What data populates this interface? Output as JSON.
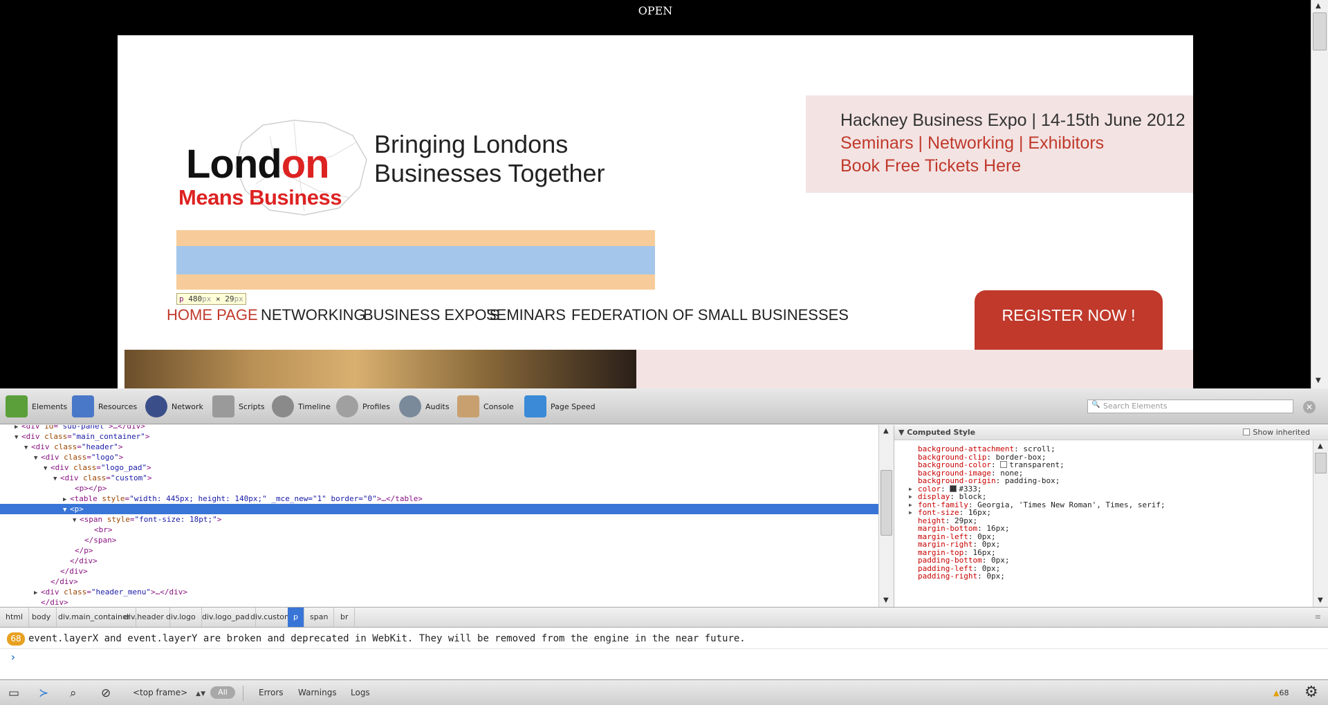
{
  "browser": {
    "open_label": "OPEN"
  },
  "website": {
    "logo": {
      "word_lond": "Lond",
      "word_on": "on",
      "subtitle": "Means Business"
    },
    "tagline_line1": "Bringing Londons",
    "tagline_line2": "Businesses Together",
    "expo": {
      "title": "Hackney Business Expo | 14-15th June 2012",
      "links": "Seminars | Networking  | Exhibitors",
      "book": "Book Free Tickets Here"
    },
    "highlight_tooltip": {
      "tag": "p",
      "width": "480",
      "height": "29",
      "unit": "px",
      "times": "×"
    },
    "nav": [
      "HOME PAGE",
      "NETWORKING",
      "BUSINESS EXPO'S",
      "SEMINARS",
      "FEDERATION OF SMALL BUSINESSES"
    ],
    "register_button": "REGISTER NOW !"
  },
  "devtools": {
    "tabs": [
      {
        "label": "Elements",
        "icon": "elements-icon"
      },
      {
        "label": "Resources",
        "icon": "resources-icon"
      },
      {
        "label": "Network",
        "icon": "network-icon"
      },
      {
        "label": "Scripts",
        "icon": "scripts-icon"
      },
      {
        "label": "Timeline",
        "icon": "timeline-icon"
      },
      {
        "label": "Profiles",
        "icon": "profiles-icon"
      },
      {
        "label": "Audits",
        "icon": "audits-icon"
      },
      {
        "label": "Console",
        "icon": "console-icon"
      },
      {
        "label": "Page Speed",
        "icon": "page-speed-icon"
      }
    ],
    "search_placeholder": "Search Elements",
    "dom_lines": [
      {
        "indent": 3,
        "tri": "▶",
        "open": "<div ",
        "attr": "id",
        "val": "\"sub-panel\"",
        "rest": ">…</div>"
      },
      {
        "indent": 3,
        "tri": "▼",
        "open": "<div ",
        "attr": "class",
        "val": "\"main_container\"",
        "rest": ">"
      },
      {
        "indent": 5,
        "tri": "▼",
        "open": "<div ",
        "attr": "class",
        "val": "\"header\"",
        "rest": ">"
      },
      {
        "indent": 7,
        "tri": "▼",
        "open": "<div ",
        "attr": "class",
        "val": "\"logo\"",
        "rest": ">"
      },
      {
        "indent": 9,
        "tri": "▼",
        "open": "<div ",
        "attr": "class",
        "val": "\"logo_pad\"",
        "rest": ">"
      },
      {
        "indent": 11,
        "tri": "▼",
        "open": "<div ",
        "attr": "class",
        "val": "\"custom\"",
        "rest": ">"
      },
      {
        "indent": 14,
        "tri": "",
        "open": "<p></p>",
        "attr": "",
        "val": "",
        "rest": ""
      },
      {
        "indent": 13,
        "tri": "▶",
        "open": "<table ",
        "attr": "style",
        "val": "\"width: 445px; height: 140px;\" _mce_new=\"1\" border=\"0\"",
        "rest": ">…</table>"
      },
      {
        "indent": 13,
        "tri": "▼",
        "open": "<p>",
        "attr": "",
        "val": "",
        "rest": "",
        "selected": true
      },
      {
        "indent": 15,
        "tri": "▼",
        "open": "<span ",
        "attr": "style",
        "val": "\"font-size: 18pt;\"",
        "rest": ">"
      },
      {
        "indent": 18,
        "tri": "",
        "open": "<br>",
        "attr": "",
        "val": "",
        "rest": ""
      },
      {
        "indent": 16,
        "tri": "",
        "open": "</span>",
        "attr": "",
        "val": "",
        "rest": ""
      },
      {
        "indent": 14,
        "tri": "",
        "open": "</p>",
        "attr": "",
        "val": "",
        "rest": ""
      },
      {
        "indent": 13,
        "tri": "",
        "open": "</div>",
        "attr": "",
        "val": "",
        "rest": ""
      },
      {
        "indent": 11,
        "tri": "",
        "open": "</div>",
        "attr": "",
        "val": "",
        "rest": ""
      },
      {
        "indent": 9,
        "tri": "",
        "open": "</div>",
        "attr": "",
        "val": "",
        "rest": ""
      },
      {
        "indent": 7,
        "tri": "▶",
        "open": "<div ",
        "attr": "class",
        "val": "\"header_menu\"",
        "rest": ">…</div>"
      },
      {
        "indent": 7,
        "tri": "",
        "open": "</div>",
        "attr": "",
        "val": "",
        "rest": ""
      }
    ],
    "computed": {
      "title": "Computed Style",
      "show_inherited": "Show inherited",
      "props": [
        {
          "name": "background-attachment",
          "value": "scroll;"
        },
        {
          "name": "background-clip",
          "value": "border-box;"
        },
        {
          "name": "background-color",
          "value": "transparent;",
          "swatch": "#ffffff"
        },
        {
          "name": "background-image",
          "value": "none;"
        },
        {
          "name": "background-origin",
          "value": "padding-box;"
        },
        {
          "name": "color",
          "value": "#333;",
          "swatch": "#333333",
          "expand": true
        },
        {
          "name": "display",
          "value": "block;",
          "expand": true
        },
        {
          "name": "font-family",
          "value": "Georgia, 'Times New Roman', Times, serif;",
          "expand": true
        },
        {
          "name": "font-size",
          "value": "16px;",
          "expand": true
        },
        {
          "name": "height",
          "value": "29px;"
        },
        {
          "name": "margin-bottom",
          "value": "16px;"
        },
        {
          "name": "margin-left",
          "value": "0px;"
        },
        {
          "name": "margin-right",
          "value": "0px;"
        },
        {
          "name": "margin-top",
          "value": "16px;"
        },
        {
          "name": "padding-bottom",
          "value": "0px;"
        },
        {
          "name": "padding-left",
          "value": "0px;"
        },
        {
          "name": "padding-right",
          "value": "0px;"
        }
      ]
    },
    "breadcrumbs": [
      "html",
      "body",
      "div.main_container",
      "div.header",
      "div.logo",
      "div.logo_pad",
      "div.custom",
      "p",
      "span",
      "br"
    ],
    "selected_crumb": "p",
    "console": {
      "warn_count": "68",
      "message": "event.layerX and event.layerY are broken and deprecated in WebKit. They will be removed from the engine in the near future.",
      "prompt": "›"
    },
    "status_bar": {
      "frame": "<top frame>",
      "filters": [
        "All",
        "Errors",
        "Warnings",
        "Logs"
      ],
      "warning_badge": "68"
    }
  }
}
